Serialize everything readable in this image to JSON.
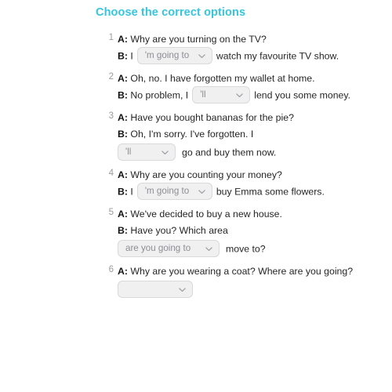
{
  "header": {
    "title": "Choose the correct options",
    "title_color": "#35c6de"
  },
  "icons": {
    "caret": "chevron-down-icon"
  },
  "questions": [
    {
      "number": "1",
      "lines": [
        {
          "type": "text",
          "speaker": "A:",
          "parts": [
            {
              "kind": "text",
              "value": "Why are you turning on the TV?"
            }
          ]
        },
        {
          "type": "text",
          "speaker": "B:",
          "parts": [
            {
              "kind": "text",
              "value": "I"
            },
            {
              "kind": "dropdown",
              "value": "'m going to",
              "width": "w-going"
            },
            {
              "kind": "text",
              "value": "watch my favourite TV show."
            }
          ]
        }
      ]
    },
    {
      "number": "2",
      "lines": [
        {
          "type": "text",
          "speaker": "A:",
          "parts": [
            {
              "kind": "text",
              "value": "Oh, no. I have forgotten my wallet at home."
            }
          ]
        },
        {
          "type": "text",
          "speaker": "B:",
          "parts": [
            {
              "kind": "text",
              "value": "No problem, I"
            },
            {
              "kind": "dropdown",
              "value": "'ll",
              "width": "w-ll"
            },
            {
              "kind": "text",
              "value": "lend you some money."
            }
          ]
        }
      ]
    },
    {
      "number": "3",
      "lines": [
        {
          "type": "text",
          "speaker": "A:",
          "parts": [
            {
              "kind": "text",
              "value": "Have you bought bananas for the pie?"
            }
          ]
        },
        {
          "type": "text",
          "speaker": "B:",
          "parts": [
            {
              "kind": "text",
              "value": "Oh, I'm sorry. I've forgotten. I"
            }
          ]
        },
        {
          "type": "block",
          "parts": [
            {
              "kind": "dropdown",
              "value": "'ll",
              "width": "w-ll"
            },
            {
              "kind": "text",
              "value": "go and buy them now."
            }
          ]
        }
      ]
    },
    {
      "number": "4",
      "lines": [
        {
          "type": "text",
          "speaker": "A:",
          "parts": [
            {
              "kind": "text",
              "value": "Why are you counting your money?"
            }
          ]
        },
        {
          "type": "text",
          "speaker": "B:",
          "parts": [
            {
              "kind": "text",
              "value": "I"
            },
            {
              "kind": "dropdown",
              "value": "'m going to",
              "width": "w-going"
            },
            {
              "kind": "text",
              "value": "buy Emma some flowers."
            }
          ]
        }
      ]
    },
    {
      "number": "5",
      "lines": [
        {
          "type": "text",
          "speaker": "A:",
          "parts": [
            {
              "kind": "text",
              "value": "We've decided to buy a new house."
            }
          ]
        },
        {
          "type": "text",
          "speaker": "B:",
          "parts": [
            {
              "kind": "text",
              "value": "Have you? Which area"
            }
          ]
        },
        {
          "type": "block",
          "parts": [
            {
              "kind": "dropdown",
              "value": "are you going to",
              "width": "w-areyou"
            },
            {
              "kind": "text",
              "value": "move to?"
            }
          ]
        }
      ]
    },
    {
      "number": "6",
      "lines": [
        {
          "type": "text",
          "speaker": "A:",
          "parts": [
            {
              "kind": "text",
              "value": "Why are you wearing a coat? Where are you going?"
            }
          ]
        },
        {
          "type": "block",
          "parts": [
            {
              "kind": "dropdown",
              "value": "",
              "width": "w-going"
            }
          ]
        }
      ]
    }
  ]
}
